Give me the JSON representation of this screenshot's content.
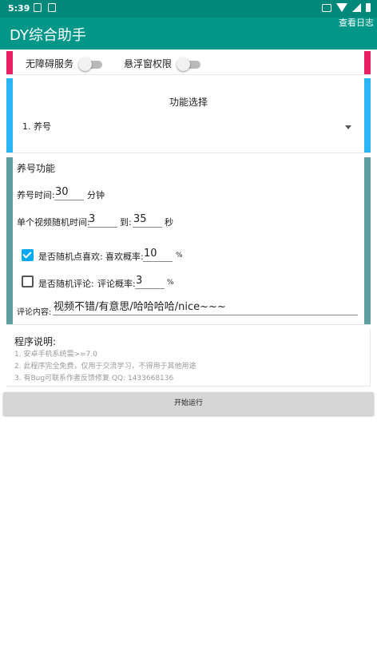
{
  "status_bar": {
    "time": "5:39"
  },
  "app_bar": {
    "title": "DY综合助手",
    "log_button": "查看日志"
  },
  "permissions": {
    "accessibility_label": "无障碍服务",
    "accessibility_enabled": false,
    "overlay_label": "悬浮窗权限",
    "overlay_enabled": false
  },
  "function_select": {
    "title": "功能选择",
    "selected": "1. 养号"
  },
  "nurture": {
    "title": "养号功能",
    "duration_label": "养号时间:",
    "duration_value": "30",
    "duration_unit": "分钟",
    "video_time_label": "单个视频随机时间:",
    "video_time_min": "3",
    "video_time_to": "到:",
    "video_time_max": "35",
    "video_time_unit": "秒",
    "random_like_label": "是否随机点喜欢:",
    "random_like_checked": true,
    "like_rate_label": "喜欢概率:",
    "like_rate_value": "10",
    "like_rate_unit": "%",
    "random_comment_label": "是否随机评论:",
    "random_comment_checked": false,
    "comment_rate_label": "评论概率:",
    "comment_rate_value": "3",
    "comment_rate_unit": "%",
    "comment_content_label": "评论内容:",
    "comment_content_value": "视频不错/有意思/哈哈哈哈/nice~~~"
  },
  "description": {
    "title": "程序说明:",
    "lines": [
      "1. 安卓手机系统需>=7.0",
      "2. 此程序完全免费，仅用于交流学习，不得用于其他用途",
      "3. 有Bug可联系作者反馈修复 QQ: 1433668136"
    ]
  },
  "start_button": "开始运行",
  "colors": {
    "status_bar": "#00897b",
    "app_bar": "#009688",
    "card1_accent": "#e91e63",
    "card2_accent": "#29b6f6",
    "card3_accent": "#5f9ea0",
    "checkbox_on": "#03a9f4"
  }
}
